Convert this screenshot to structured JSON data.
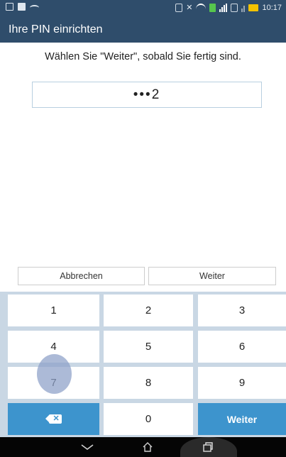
{
  "status_bar": {
    "time": "10:17"
  },
  "header": {
    "title": "Ihre PIN einrichten"
  },
  "prompt": {
    "text": "Wählen Sie \"Weiter\", sobald Sie fertig sind."
  },
  "pin_field": {
    "value": "•••2"
  },
  "actions": {
    "cancel_label": "Abbrechen",
    "next_label": "Weiter"
  },
  "keypad": {
    "keys": [
      "1",
      "2",
      "3",
      "4",
      "5",
      "6",
      "7",
      "8",
      "9",
      "0"
    ],
    "enter_label": "Weiter"
  },
  "colors": {
    "header_bg": "#2f4d6b",
    "keypad_bg": "#c9d7e4",
    "accent_blue": "#3d94cd",
    "nav_bg": "#050505"
  },
  "icons": [
    "backspace-icon",
    "back-icon",
    "home-icon",
    "recent-apps-icon",
    "wifi-icon",
    "battery-icon"
  ]
}
